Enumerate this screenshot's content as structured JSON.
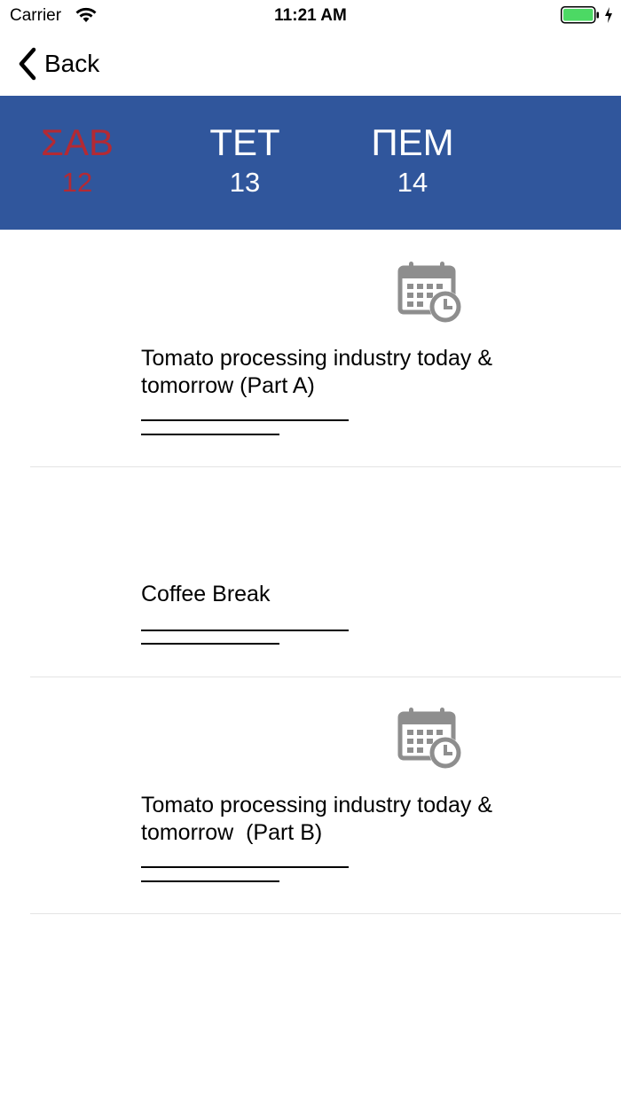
{
  "status_bar": {
    "carrier": "Carrier",
    "time": "11:21 AM",
    "battery_color": "#4cd964"
  },
  "nav": {
    "back_label": "Back"
  },
  "days": [
    {
      "name": "ΣΑΒ",
      "number": "12",
      "selected": true
    },
    {
      "name": "ΤΕΤ",
      "number": "13",
      "selected": false
    },
    {
      "name": "ΠΕΜ",
      "number": "14",
      "selected": false
    }
  ],
  "colors": {
    "header_bg": "#30569c",
    "selected_day": "#b32a34",
    "icon_gray": "#8e8e8e"
  },
  "sessions": [
    {
      "title_line1": "Tomato processing industry today &",
      "title_line2": "tomorrow (Part A)",
      "icon": "calendar-clock-icon"
    },
    {
      "title_line1": "Coffee Break",
      "title_line2": "",
      "icon": ""
    },
    {
      "title_line1": "Tomato processing industry today &",
      "title_line2": "tomorrow  (Part B)",
      "icon": "calendar-clock-icon"
    }
  ]
}
